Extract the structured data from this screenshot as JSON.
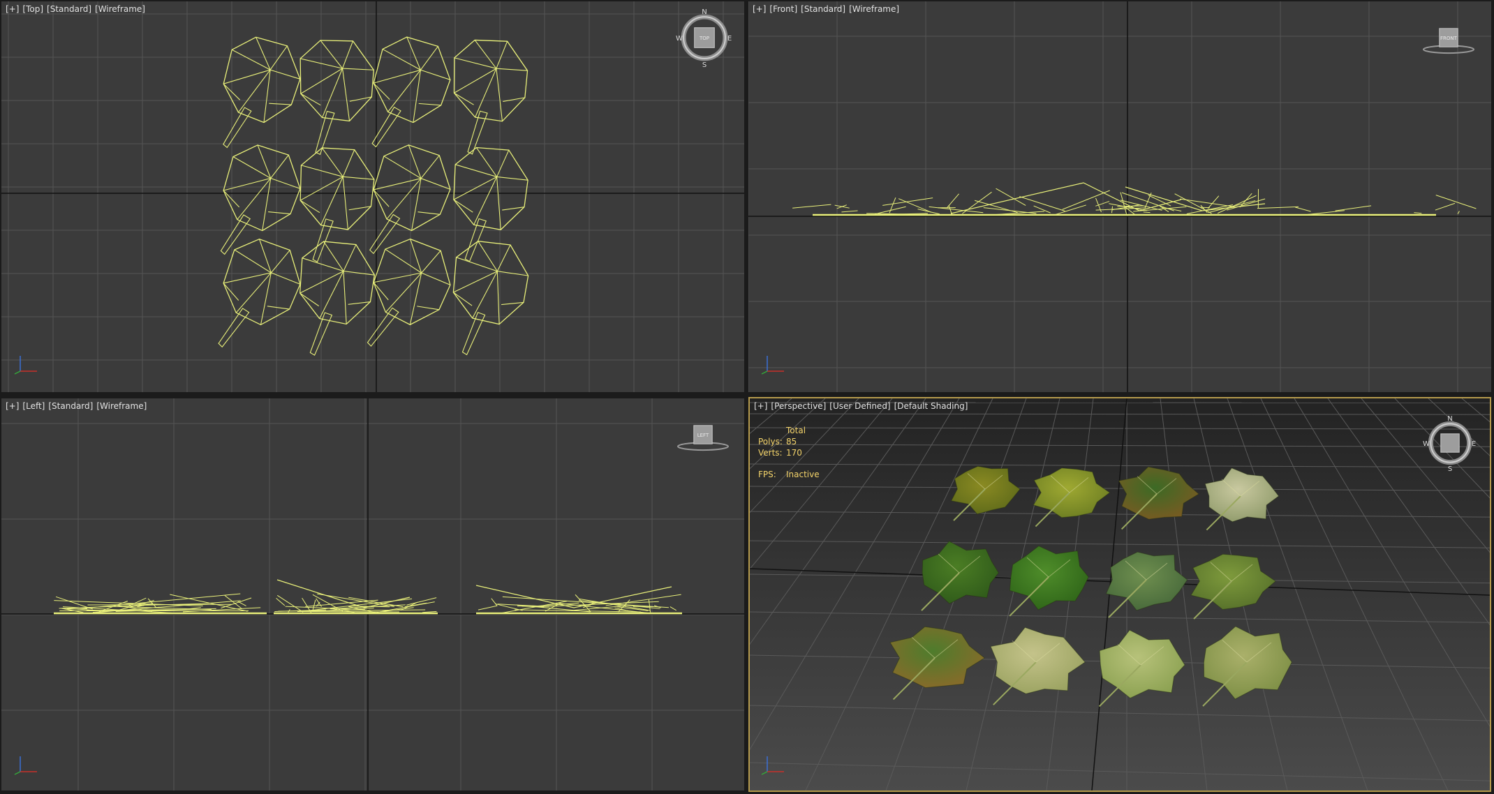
{
  "viewports": {
    "top": {
      "bracket": "[+]",
      "view": "[Top]",
      "mode": "[Standard]",
      "shading": "[Wireframe]",
      "cube_label": "TOP",
      "compass": {
        "n": "N",
        "s": "S",
        "e": "E",
        "w": "W"
      }
    },
    "front": {
      "bracket": "[+]",
      "view": "[Front]",
      "mode": "[Standard]",
      "shading": "[Wireframe]",
      "cube_label": "FRONT"
    },
    "left": {
      "bracket": "[+]",
      "view": "[Left]",
      "mode": "[Standard]",
      "shading": "[Wireframe]",
      "cube_label": "LEFT"
    },
    "perspective": {
      "bracket": "[+]",
      "view": "[Perspective]",
      "mode": "[User Defined]",
      "shading": "[Default Shading]",
      "compass": {
        "n": "N",
        "s": "S",
        "e": "E",
        "w": "W"
      }
    }
  },
  "stats": {
    "header": "Total",
    "polys_label": "Polys:",
    "polys_value": "85",
    "verts_label": "Verts:",
    "verts_value": "170",
    "fps_label": "FPS:",
    "fps_value": "Inactive"
  },
  "colors": {
    "viewport_bg": "#3b3b3b",
    "grid": "#555555",
    "axis": "#111111",
    "wireframe": "#e9f07a",
    "active_border": "#b59a4c",
    "stats_text": "#f3d36a"
  },
  "icons": [
    "viewcube-icon",
    "compass-ring-icon",
    "axis-tripod-icon",
    "leaf-wireframe-icon",
    "leaf-textured-icon"
  ],
  "scene": {
    "object_count": 12,
    "rows": 3,
    "columns": 4
  }
}
